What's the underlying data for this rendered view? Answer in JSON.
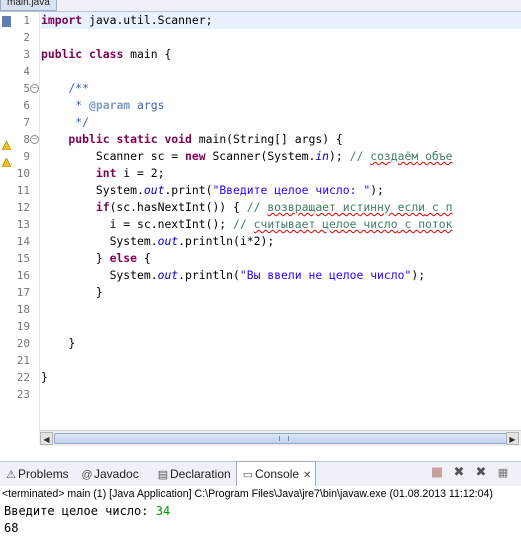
{
  "editor": {
    "tab_title": "main.java",
    "line_numbers": [
      "1",
      "2",
      "3",
      "4",
      "5",
      "6",
      "7",
      "8",
      "9",
      "10",
      "11",
      "12",
      "13",
      "14",
      "15",
      "16",
      "17",
      "18",
      "19",
      "20",
      "21",
      "22",
      "23"
    ],
    "code": {
      "l1_kw": "import",
      "l1_rest": " java.util.Scanner;",
      "l3_kw1": "public",
      "l3_kw2": "class",
      "l3_rest": " main {",
      "l5": "    /**",
      "l6_a": "     * ",
      "l6_tag": "@param",
      "l6_b": " args",
      "l7": "     */",
      "l8_kw1": "    public",
      "l8_kw2": "static",
      "l8_kw3": "void",
      "l8_rest": " main(String[] args) {",
      "l9_a": "        Scanner sc = ",
      "l9_kw": "new",
      "l9_b": " Scanner(System.",
      "l9_it": "in",
      "l9_c": "); ",
      "l9_cm_a": "// ",
      "l9_cm_sp": "создаём",
      "l9_cm_b": " объе",
      "l10_kw": "        int",
      "l10_rest": " i = 2;",
      "l11_a": "        System.",
      "l11_it": "out",
      "l11_b": ".print(",
      "l11_str": "\"Введите целое число: \"",
      "l11_c": ");",
      "l12_kw": "        if",
      "l12_a": "(sc.hasNextInt()) { ",
      "l12_cm_a": "// ",
      "l12_cm_sp": "возвращает истинну если",
      "l12_cm_b": " с п",
      "l13_a": "          i = sc.nextInt(); ",
      "l13_cm_a": "// ",
      "l13_cm_sp": "считывает целое число",
      "l13_cm_b": " с поток",
      "l14_a": "          System.",
      "l14_it": "out",
      "l14_b": ".println(i*2);",
      "l15_a": "        } ",
      "l15_kw": "else",
      "l15_b": " {",
      "l16_a": "          System.",
      "l16_it": "out",
      "l16_b": ".println(",
      "l16_str": "\"Вы ввели не целое число\"",
      "l16_c": ");",
      "l17": "        }",
      "l20": "    }",
      "l22": "}"
    }
  },
  "views": {
    "tabs": [
      {
        "label": "Problems",
        "icon": "problems-icon"
      },
      {
        "label": "Javadoc",
        "icon": "at-icon"
      },
      {
        "label": "Declaration",
        "icon": "declaration-icon"
      },
      {
        "label": "Console",
        "icon": "console-icon"
      }
    ],
    "close_symbol": "✕",
    "tools": [
      "terminate-icon",
      "remove-launch-icon",
      "remove-all-terminated-icon"
    ]
  },
  "console": {
    "header": "<terminated> main (1) [Java Application] C:\\Program Files\\Java\\jre7\\bin\\javaw.exe (01.08.2013 11:12:04)",
    "prompt": "Введите целое число: ",
    "input": "34",
    "output": "68"
  },
  "colors": {
    "keyword": "#7f0055",
    "comment": "#3f7f5f",
    "string": "#2a00ff",
    "field": "#0000c0",
    "current_line": "#e8f2fe",
    "console_input": "#009a00"
  }
}
